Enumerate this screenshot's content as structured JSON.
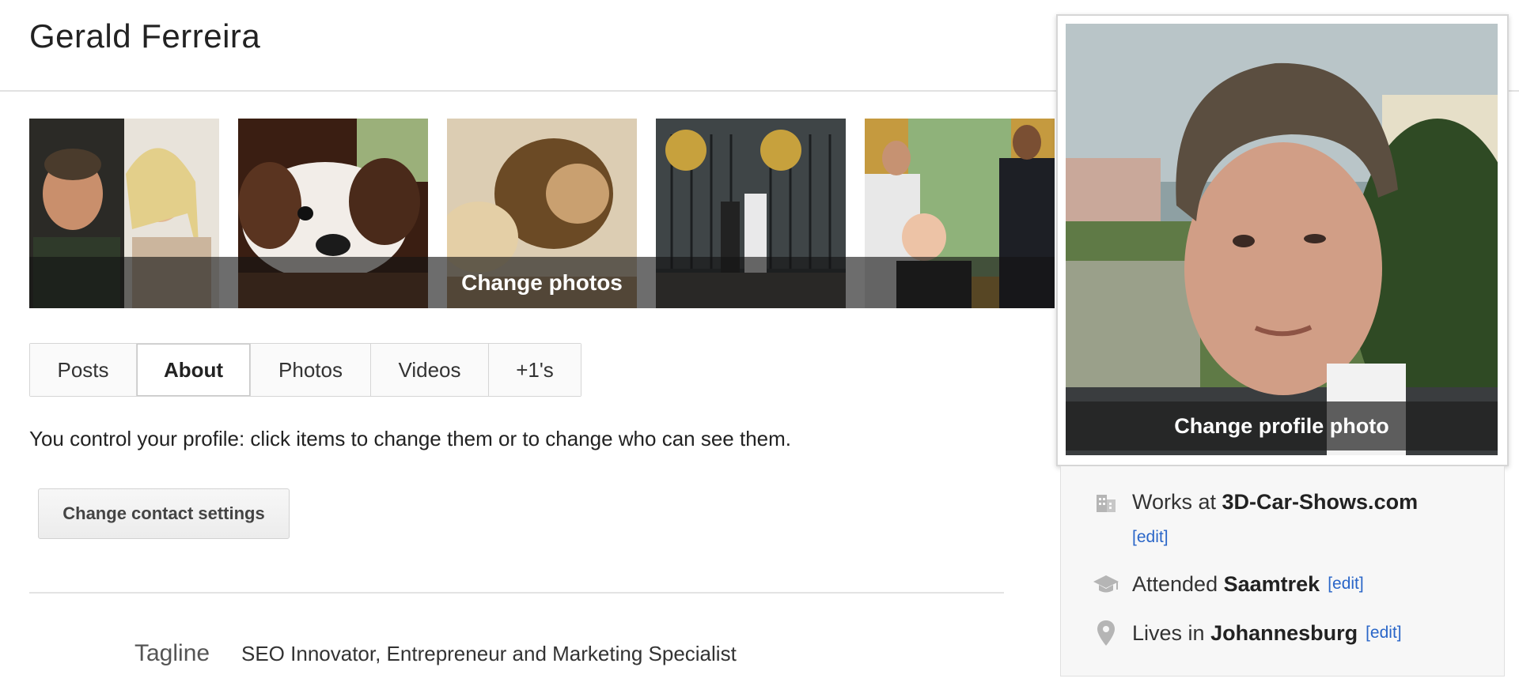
{
  "profile": {
    "name": "Gerald Ferreira"
  },
  "cover": {
    "change_label": "Change photos"
  },
  "tabs": [
    {
      "label": "Posts",
      "active": false
    },
    {
      "label": "About",
      "active": true
    },
    {
      "label": "Photos",
      "active": false
    },
    {
      "label": "Videos",
      "active": false
    },
    {
      "label": "+1's",
      "active": false
    }
  ],
  "about": {
    "control_text": "You control your profile: click items to change them or to change who can see them.",
    "contact_button": "Change contact settings",
    "tagline_label": "Tagline",
    "tagline_value": "SEO Innovator, Entrepreneur and Marketing Specialist"
  },
  "profile_photo": {
    "change_label": "Change profile photo"
  },
  "info": {
    "work": {
      "prefix": "Works at ",
      "value": "3D-Car-Shows.com",
      "edit": "[edit]",
      "icon": "building-icon"
    },
    "education": {
      "prefix": "Attended ",
      "value": "Saamtrek",
      "edit": "[edit]",
      "icon": "graduation-cap-icon"
    },
    "location": {
      "prefix": "Lives in ",
      "value": "Johannesburg",
      "edit": "[edit]",
      "icon": "map-pin-icon"
    }
  },
  "colors": {
    "link": "#2a66c8",
    "border": "#d6d6d6",
    "panel": "#f7f7f7"
  }
}
